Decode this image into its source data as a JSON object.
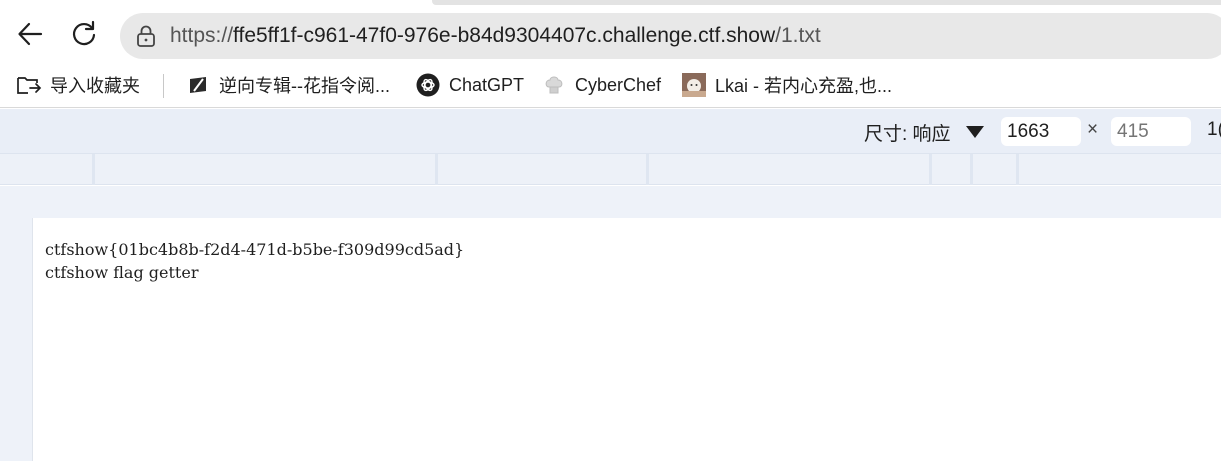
{
  "browser": {
    "url_scheme": "https://",
    "url_host": "ffe5ff1f-c961-47f0-976e-b84d9304407c.challenge.ctf.show",
    "url_path": "/1.txt"
  },
  "bookmarks": [
    {
      "label": "导入收藏夹",
      "icon": "import-folder-icon"
    },
    {
      "label": "逆向专辑--花指令阅...",
      "icon": "bookmark-favicon"
    },
    {
      "label": "ChatGPT",
      "icon": "chatgpt-logo"
    },
    {
      "label": "CyberChef",
      "icon": "chef-hat-icon"
    },
    {
      "label": "Lkai - 若内心充盈,也...",
      "icon": "avatar-favicon"
    }
  ],
  "devtools": {
    "size_label": "尺寸: 响应",
    "width_value": "1663",
    "height_placeholder": "415",
    "times": "×",
    "extra": "1("
  },
  "page": {
    "lines": [
      "ctfshow{01bc4b8b-f2d4-471d-b5be-f309d99cd5ad}",
      "ctfshow flag getter"
    ]
  }
}
